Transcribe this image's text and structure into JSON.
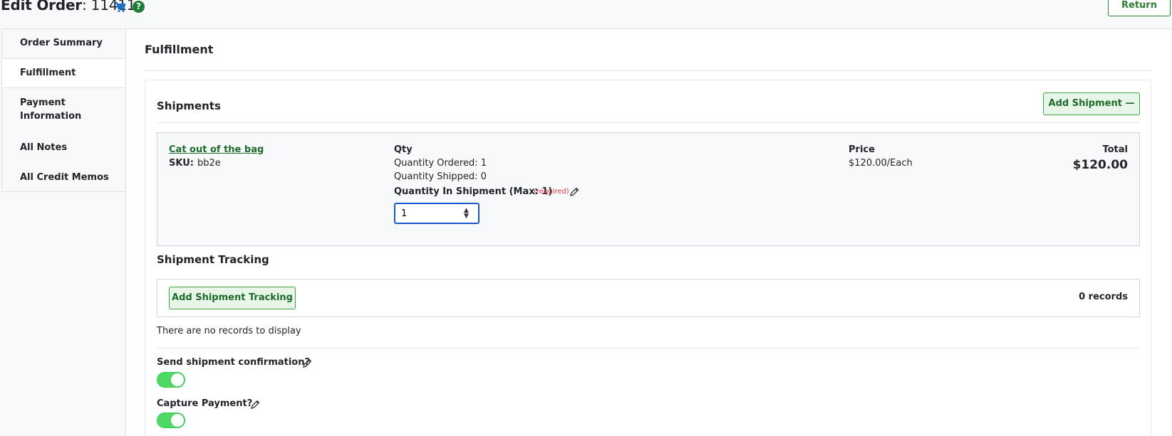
{
  "header": {
    "title_bold": "Edit Order",
    "title_rest": ": 11411",
    "cart_icon": "shopping-cart-icon",
    "help_icon": "question-circle-icon",
    "help_glyph": "?",
    "return_label": "Return"
  },
  "sidebar": {
    "items": [
      {
        "label": "Order Summary",
        "active": false
      },
      {
        "label": "Fulfillment",
        "active": true
      },
      {
        "label": "Payment Information",
        "active": false
      },
      {
        "label": "All Notes",
        "active": false
      },
      {
        "label": "All Credit Memos",
        "active": false
      }
    ]
  },
  "main": {
    "section_title": "Fulfillment",
    "shipments": {
      "title": "Shipments",
      "add_label": "Add Shipment —",
      "item": {
        "name": "Cat out of the bag",
        "sku_label": "SKU:",
        "sku": "bb2e",
        "qty_heading": "Qty",
        "qty_ordered": "Quantity Ordered: 1",
        "qty_shipped": "Quantity Shipped: 0",
        "qty_in_shipment_label": "Quantity In Shipment (Max: 1)",
        "required_text": "(required)",
        "qty_in_shipment_value": "1",
        "price_heading": "Price",
        "price": "$120.00/Each",
        "total_heading": "Total",
        "total": "$120.00"
      }
    },
    "tracking": {
      "title": "Shipment Tracking",
      "add_label": "Add Shipment Tracking",
      "records": "0 records",
      "empty_text": "There are no records to display"
    },
    "options": {
      "send_confirmation_label": "Send shipment confirmation?",
      "send_confirmation_on": true,
      "capture_payment_label": "Capture Payment?",
      "capture_payment_on": true
    }
  },
  "colors": {
    "accent_green": "#1e6b2a",
    "button_bg": "#e8f5e9",
    "toggle_on": "#4cd964",
    "focus_blue": "#1a56c9",
    "required_red": "#dc3545"
  }
}
